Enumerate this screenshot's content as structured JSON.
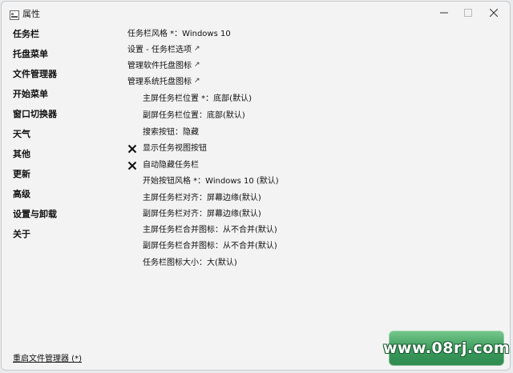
{
  "window": {
    "title": "属性"
  },
  "sidebar": {
    "items": [
      {
        "label": "任务栏"
      },
      {
        "label": "托盘菜单"
      },
      {
        "label": "文件管理器"
      },
      {
        "label": "开始菜单"
      },
      {
        "label": "窗口切换器"
      },
      {
        "label": "天气"
      },
      {
        "label": "其他"
      },
      {
        "label": "更新"
      },
      {
        "label": "高级"
      },
      {
        "label": "设置与卸载"
      },
      {
        "label": "关于"
      }
    ],
    "restart_link": "重启文件管理器 (*)"
  },
  "options": [
    {
      "label": "任务栏风格 *：Windows 10",
      "external": false,
      "check": ""
    },
    {
      "label": "设置 - 任务栏选项",
      "external": true,
      "check": ""
    },
    {
      "label": "管理软件托盘图标",
      "external": true,
      "check": ""
    },
    {
      "label": "管理系统托盘图标",
      "external": true,
      "check": ""
    },
    {
      "label": "主屏任务栏位置 *：底部(默认)",
      "external": false,
      "check": ""
    },
    {
      "label": "副屏任务栏位置：底部(默认)",
      "external": false,
      "check": ""
    },
    {
      "label": "搜索按钮：隐藏",
      "external": false,
      "check": ""
    },
    {
      "label": "显示任务视图按钮",
      "external": false,
      "check": "x"
    },
    {
      "label": "自动隐藏任务栏",
      "external": false,
      "check": "x"
    },
    {
      "label": "开始按钮风格 *：Windows 10 (默认)",
      "external": false,
      "check": ""
    },
    {
      "label": "主屏任务栏对齐：屏幕边缘(默认)",
      "external": false,
      "check": ""
    },
    {
      "label": "副屏任务栏对齐：屏幕边缘(默认)",
      "external": false,
      "check": ""
    },
    {
      "label": "主屏任务栏合并图标：从不合并(默认)",
      "external": false,
      "check": ""
    },
    {
      "label": "副屏任务栏合并图标：从不合并(默认)",
      "external": false,
      "check": ""
    },
    {
      "label": "任务栏图标大小：大(默认)",
      "external": false,
      "check": ""
    }
  ],
  "external_glyph": "↗",
  "watermark": {
    "text": "www.08rj.com"
  },
  "icons": {
    "app": "app-icon",
    "minimize": "minimize-icon",
    "maximize": "maximize-icon",
    "close": "close-icon",
    "check": "x-mark-icon"
  },
  "colors": {
    "background": "#f3f3f3",
    "text": "#111111",
    "watermark": "#3a9a5c"
  }
}
